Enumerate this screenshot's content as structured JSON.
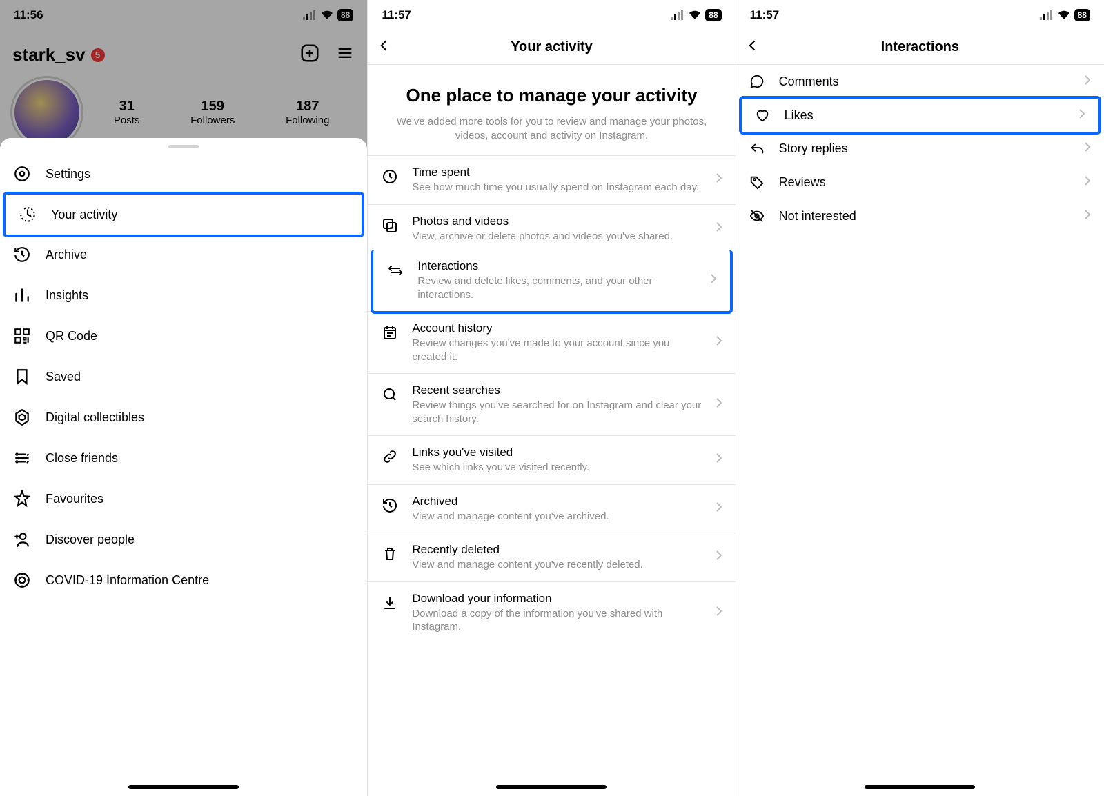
{
  "status": {
    "time_a": "11:56",
    "time_b": "11:57",
    "battery": "88"
  },
  "phone1": {
    "username": "stark_sv",
    "notif": "5",
    "stats": {
      "posts_n": "31",
      "posts_l": "Posts",
      "followers_n": "159",
      "followers_l": "Followers",
      "following_n": "187",
      "following_l": "Following"
    },
    "menu": [
      {
        "label": "Settings"
      },
      {
        "label": "Your activity",
        "hl": true
      },
      {
        "label": "Archive"
      },
      {
        "label": "Insights"
      },
      {
        "label": "QR Code"
      },
      {
        "label": "Saved"
      },
      {
        "label": "Digital collectibles"
      },
      {
        "label": "Close friends"
      },
      {
        "label": "Favourites"
      },
      {
        "label": "Discover people"
      },
      {
        "label": "COVID-19 Information Centre"
      }
    ]
  },
  "phone2": {
    "title": "Your activity",
    "big": "One place to manage your activity",
    "sub": "We've added more tools for you to review and manage your photos, videos, account and activity on Instagram.",
    "items": [
      {
        "t": "Time spent",
        "s": "See how much time you usually spend on Instagram each day."
      },
      {
        "t": "Photos and videos",
        "s": "View, archive or delete photos and videos you've shared."
      },
      {
        "t": "Interactions",
        "s": "Review and delete likes, comments, and your other interactions.",
        "hl": true
      },
      {
        "t": "Account history",
        "s": "Review changes you've made to your account since you created it."
      },
      {
        "t": "Recent searches",
        "s": "Review things you've searched for on Instagram and clear your search history."
      },
      {
        "t": "Links you've visited",
        "s": "See which links you've visited recently."
      },
      {
        "t": "Archived",
        "s": "View and manage content you've archived."
      },
      {
        "t": "Recently deleted",
        "s": "View and manage content you've recently deleted."
      },
      {
        "t": "Download your information",
        "s": "Download a copy of the information you've shared with Instagram."
      }
    ]
  },
  "phone3": {
    "title": "Interactions",
    "items": [
      {
        "label": "Comments"
      },
      {
        "label": "Likes",
        "hl": true
      },
      {
        "label": "Story replies"
      },
      {
        "label": "Reviews"
      },
      {
        "label": "Not interested"
      }
    ]
  }
}
